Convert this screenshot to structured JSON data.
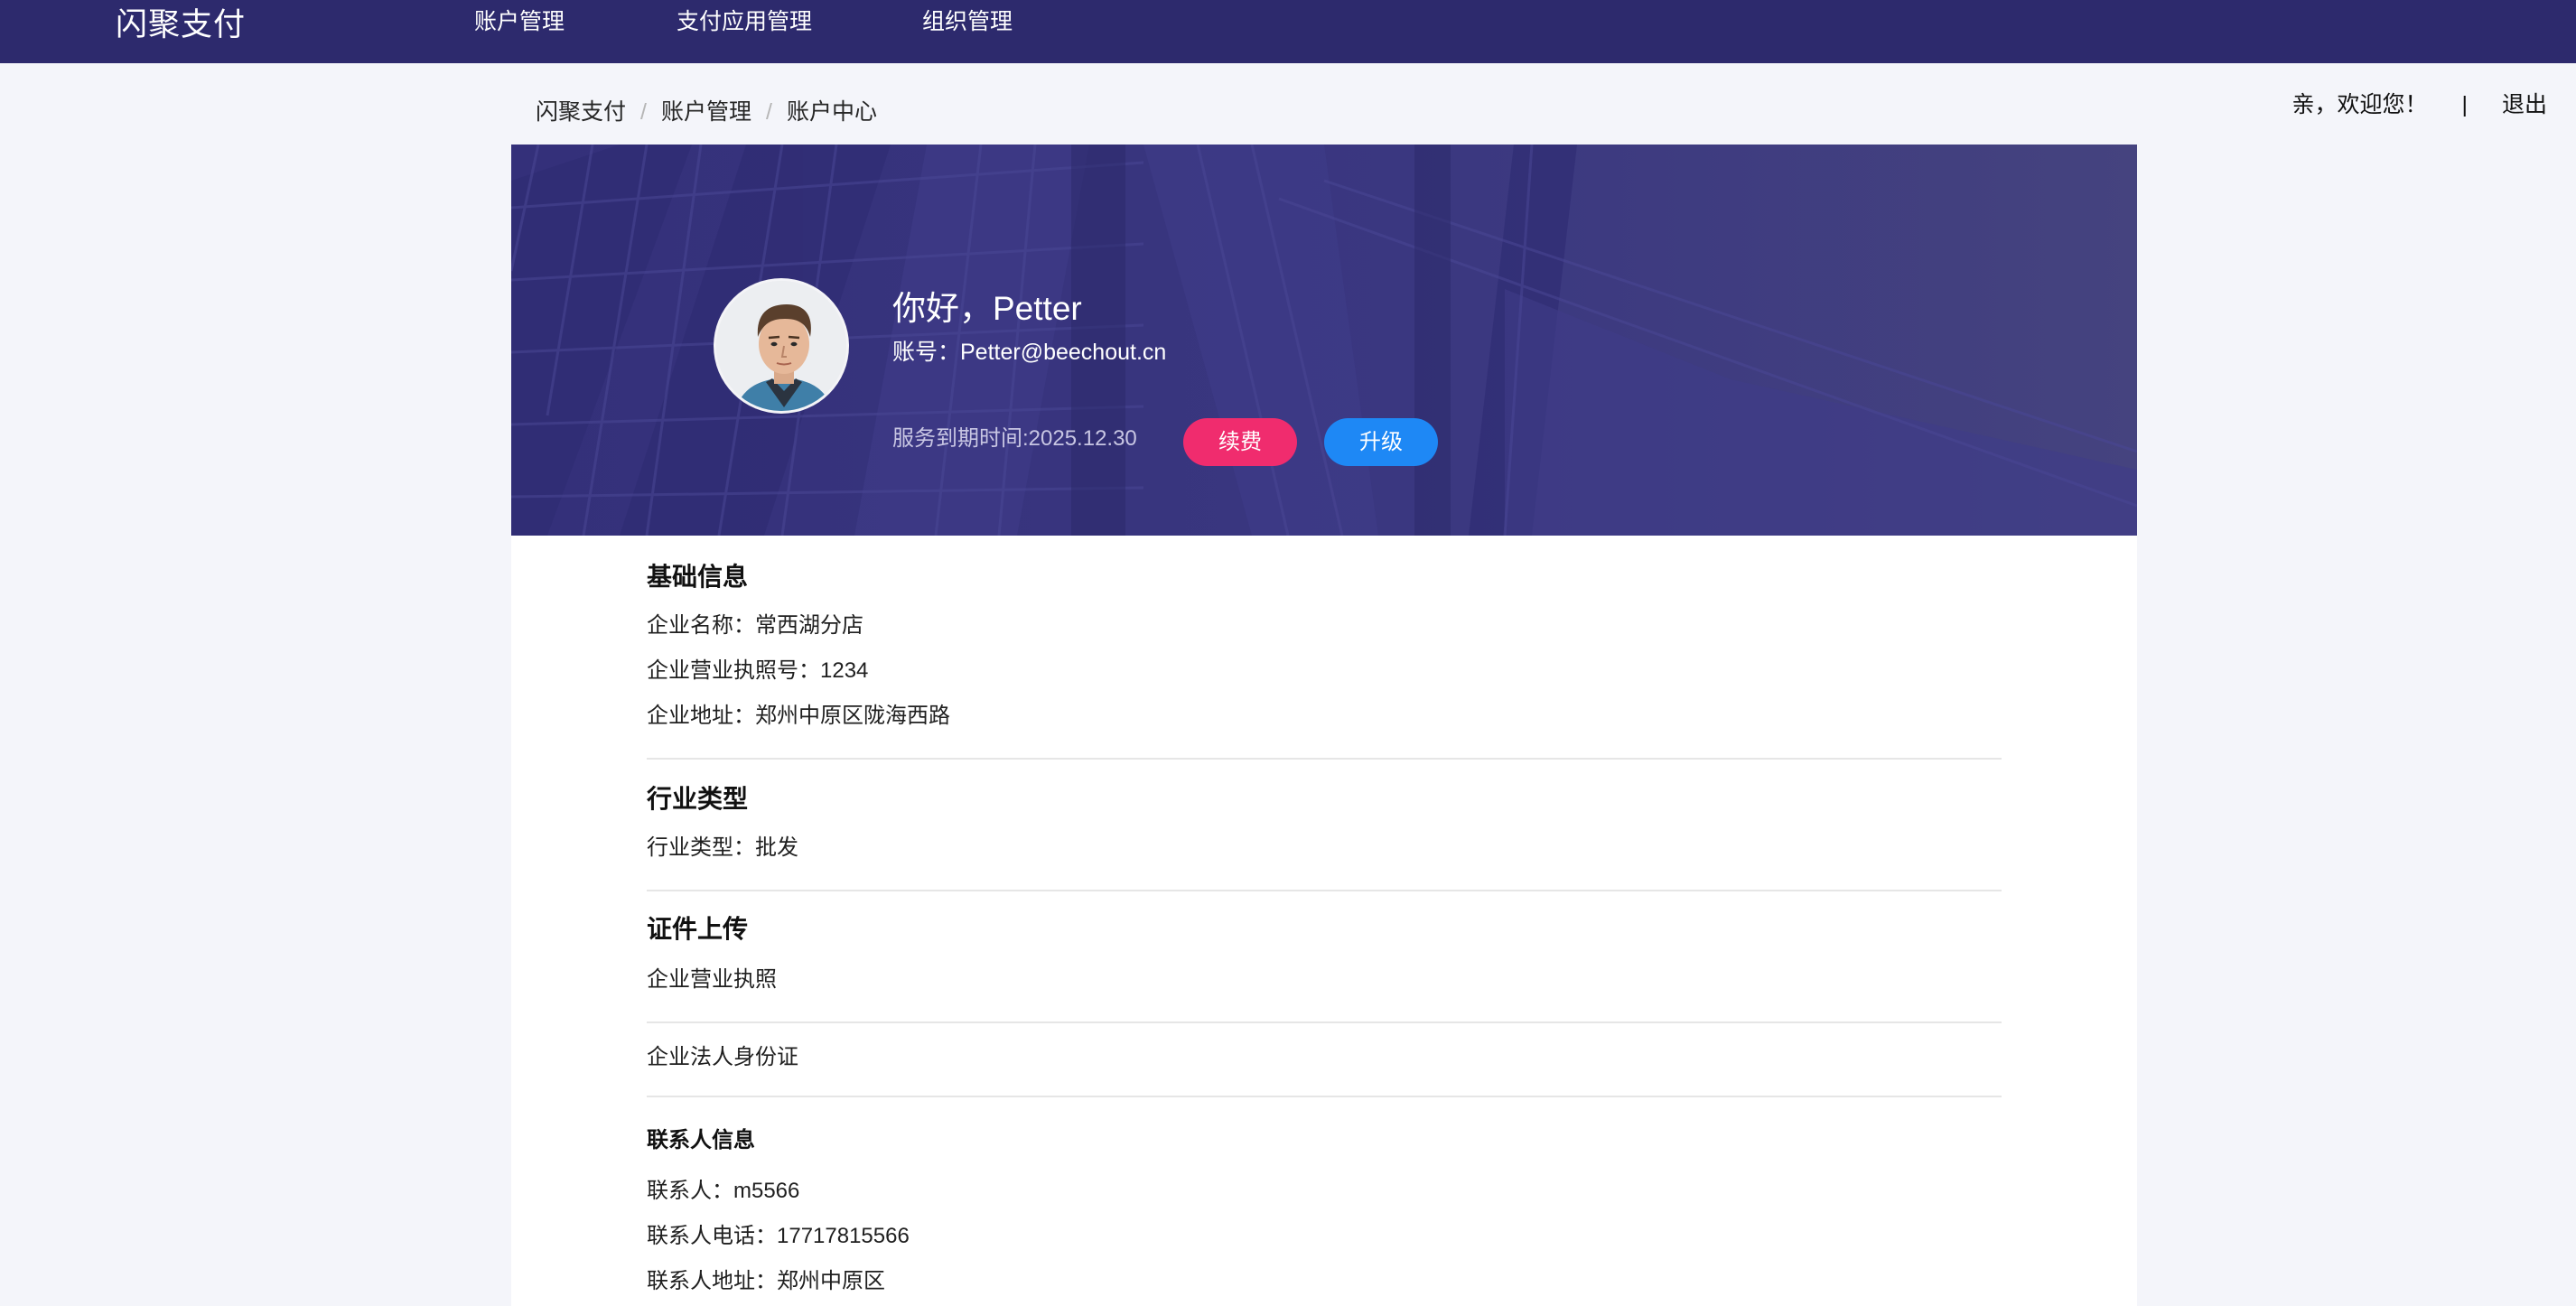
{
  "nav": {
    "brand": "闪聚支付",
    "items": [
      "账户管理",
      "支付应用管理",
      "组织管理"
    ]
  },
  "breadcrumb": {
    "items": [
      "闪聚支付",
      "账户管理",
      "账户中心"
    ],
    "separator": "/"
  },
  "header_right": {
    "welcome": "亲，欢迎您！",
    "divider": "|",
    "logout": "退出"
  },
  "profile": {
    "greeting": "你好，Petter",
    "account": "账号：Petter@beechout.cn",
    "service_expiry": "服务到期时间:2025.12.30",
    "renew_label": "续费",
    "upgrade_label": "升级"
  },
  "sections": {
    "basic": {
      "title": "基础信息",
      "rows": [
        "企业名称：常西湖分店",
        "企业营业执照号：1234",
        "企业地址：郑州中原区陇海西路"
      ]
    },
    "industry": {
      "title": "行业类型",
      "rows": [
        "行业类型：批发"
      ]
    },
    "certificates": {
      "title": "证件上传",
      "rows": [
        "企业营业执照",
        "企业法人身份证"
      ]
    },
    "contact": {
      "title": "联系人信息",
      "rows": [
        "联系人：m5566",
        "联系人电话：17717815566",
        "联系人地址：郑州中原区"
      ]
    }
  },
  "colors": {
    "nav_bg": "#2d2a6d",
    "banner_bg": "#39367d",
    "renew_btn": "#f02c6e",
    "upgrade_btn": "#1e88f5"
  }
}
